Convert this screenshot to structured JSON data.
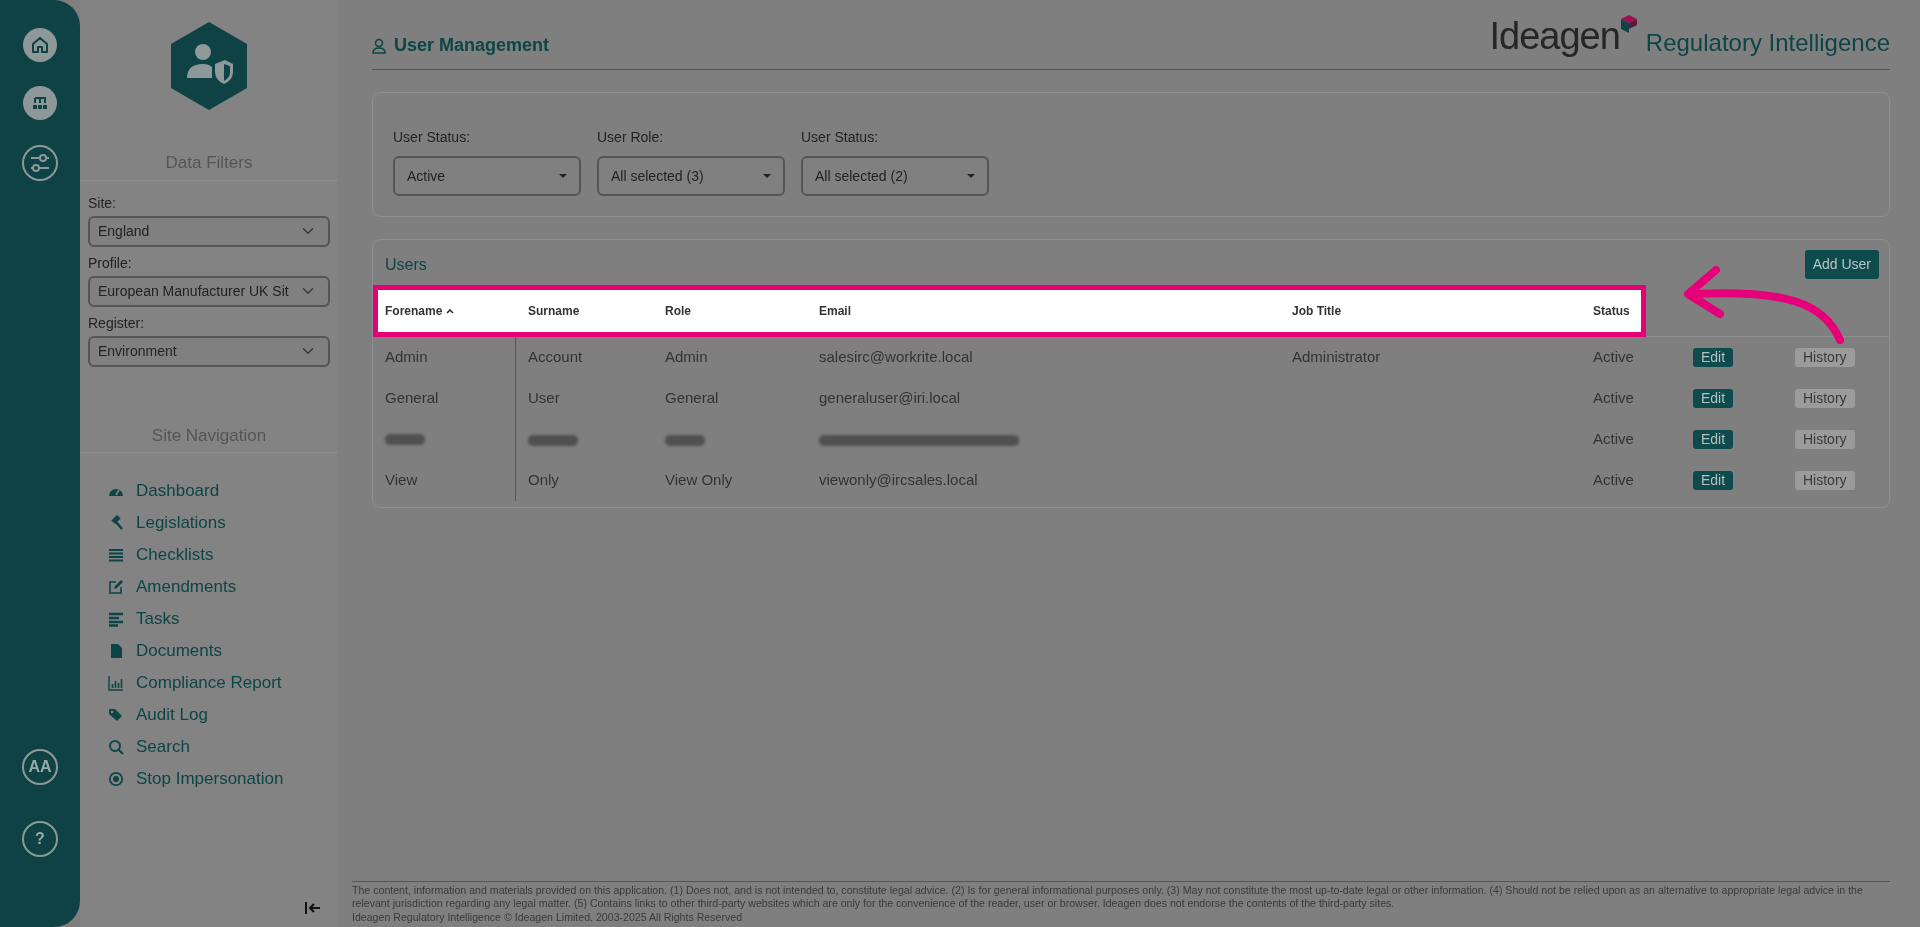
{
  "rail": {
    "avatar": "AA",
    "help": "?"
  },
  "sidebar": {
    "filters_title": "Data Filters",
    "filters": [
      {
        "label": "Site:",
        "value": "England"
      },
      {
        "label": "Profile:",
        "value": "European Manufacturer UK Sit"
      },
      {
        "label": "Register:",
        "value": "Environment"
      }
    ],
    "nav_title": "Site Navigation",
    "nav": [
      {
        "label": "Dashboard"
      },
      {
        "label": "Legislations"
      },
      {
        "label": "Checklists"
      },
      {
        "label": "Amendments"
      },
      {
        "label": "Tasks"
      },
      {
        "label": "Documents"
      },
      {
        "label": "Compliance Report"
      },
      {
        "label": "Audit Log"
      },
      {
        "label": "Search"
      },
      {
        "label": "Stop Impersonation"
      }
    ]
  },
  "page_title": "User Management",
  "logo": {
    "brand": "Ideagen",
    "product": "Regulatory Intelligence"
  },
  "filters": [
    {
      "label": "User Status:",
      "value": "Active"
    },
    {
      "label": "User Role:",
      "value": "All selected (3)"
    },
    {
      "label": "User Status:",
      "value": "All selected (2)"
    }
  ],
  "users": {
    "title": "Users",
    "add_button": "Add User",
    "columns": [
      {
        "label": "Forename",
        "sorted": true
      },
      {
        "label": "Surname",
        "sorted": false
      },
      {
        "label": "Role",
        "sorted": false
      },
      {
        "label": "Email",
        "sorted": false
      },
      {
        "label": "Job Title",
        "sorted": false
      },
      {
        "label": "Status",
        "sorted": false
      }
    ],
    "rows": [
      {
        "kind": "user",
        "forename": "Admin",
        "surname": "Account",
        "role": "Admin",
        "email": "salesirc@workrite.local",
        "job_title": "Administrator",
        "status": "Active",
        "edit": "Edit",
        "history": "History"
      },
      {
        "kind": "user",
        "forename": "General",
        "surname": "User",
        "role": "General",
        "email": "generaluser@iri.local",
        "status": "Active",
        "edit": "Edit",
        "history": "History"
      },
      {
        "kind": "redacted",
        "status": "Active",
        "edit": "Edit",
        "history": "History"
      },
      {
        "kind": "user",
        "forename": "View",
        "surname": "Only",
        "role": "View Only",
        "email": "viewonly@ircsales.local",
        "status": "Active",
        "edit": "Edit",
        "history": "History"
      }
    ]
  },
  "footer": {
    "disclaimer": "The content, information and materials provided on this application. (1) Does not, and is not intended to, constitute legal advice. (2) Is for general informational purposes only. (3) May not constitute the most up-to-date legal or other information. (4) Should not be relied upon as an alternative to appropriate legal advice in the relevant jurisdiction regarding any legal matter. (5) Contains links to other third-party websites which are only for the convenience of the reader, user or browser. Ideagen does not endorse the contents of the third-party sites.",
    "copyright": "Ideagen Regulatory Intelligence © Ideagen Limited. 2003-2025 All Rights Reserved"
  }
}
